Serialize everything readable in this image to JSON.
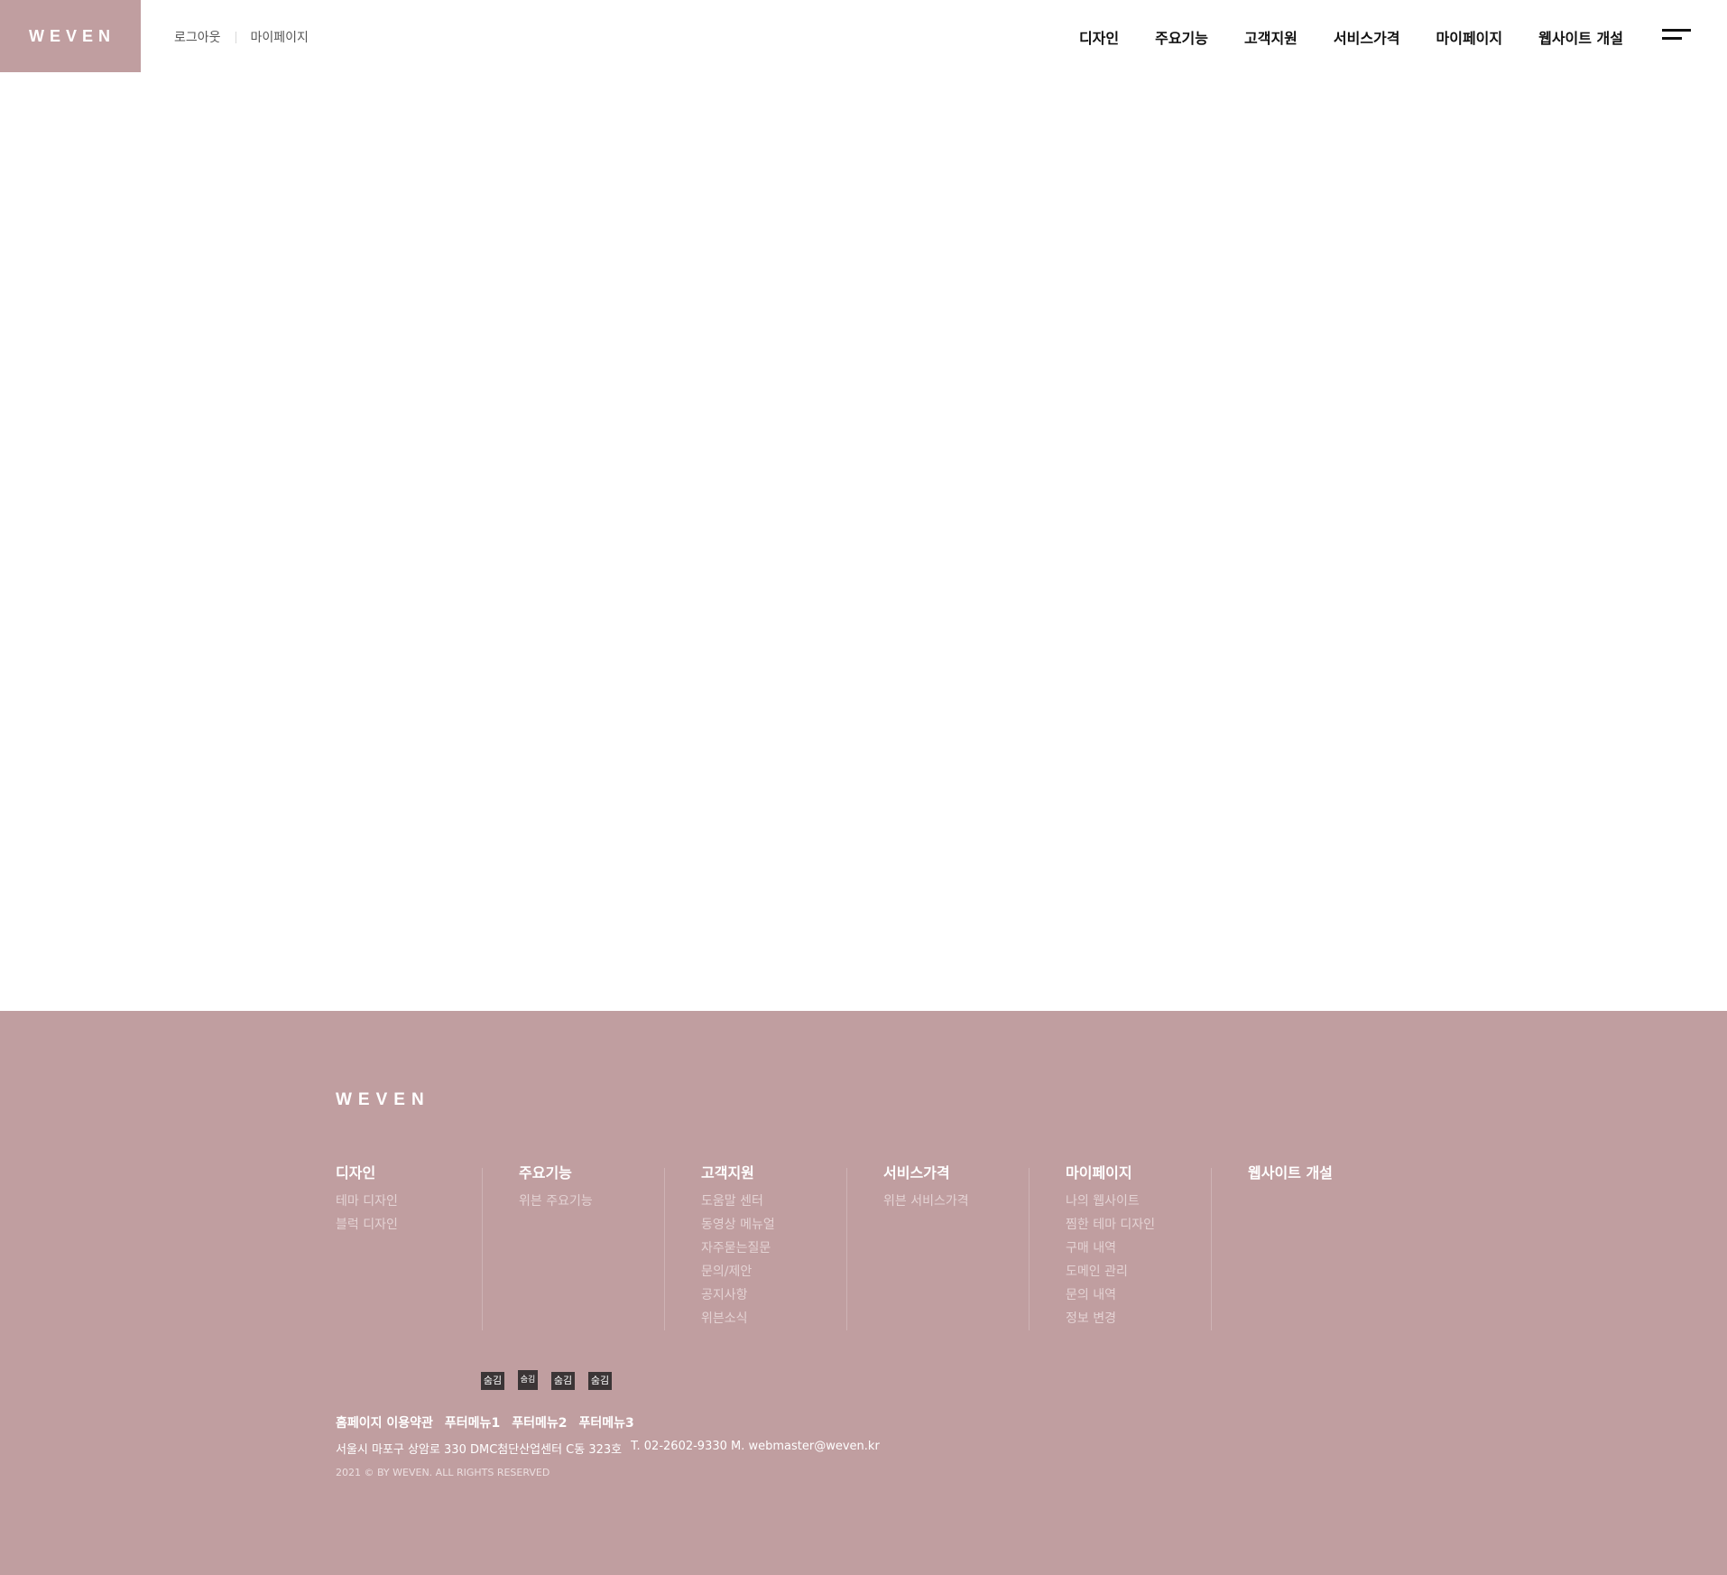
{
  "header": {
    "logo": "WEVEN",
    "util_links": [
      "로그아웃",
      "마이페이지"
    ],
    "nav": [
      "디자인",
      "주요기능",
      "고객지원",
      "서비스가격",
      "마이페이지",
      "웹사이트 개설"
    ]
  },
  "footer": {
    "logo": "WEVEN",
    "columns": [
      {
        "title": "디자인",
        "items": [
          "테마 디자인",
          "블럭 디자인"
        ]
      },
      {
        "title": "주요기능",
        "items": [
          "위븐 주요기능"
        ]
      },
      {
        "title": "고객지원",
        "items": [
          "도움말 센터",
          "동영상 메뉴얼",
          "자주묻는질문",
          "문의/제안",
          "공지사항",
          "위븐소식"
        ]
      },
      {
        "title": "서비스가격",
        "items": [
          "위븐 서비스가격"
        ]
      },
      {
        "title": "마이페이지",
        "items": [
          "나의 웹사이트",
          "찜한 테마 디자인",
          "구매 내역",
          "도메인 관리",
          "문의 내역",
          "정보 변경"
        ]
      },
      {
        "title": "웹사이트 개설",
        "items": []
      }
    ],
    "social_icons": [
      "숨김",
      "숨김",
      "숨김",
      "숨김"
    ],
    "links": [
      "홈페이지 이용약관",
      "푸터메뉴1",
      "푸터메뉴2",
      "푸터메뉴3"
    ],
    "address": "서울시 마포구 상암로 330 DMC첨단산업센터 C동 323호",
    "contact": "T. 02-2602-9330 M. webmaster@weven.kr",
    "copyright": "2021 © BY WEVEN. ALL RIGHTS RESERVED"
  },
  "colors": {
    "brand": "#c09ea0",
    "icon_bg": "#3b3536"
  }
}
